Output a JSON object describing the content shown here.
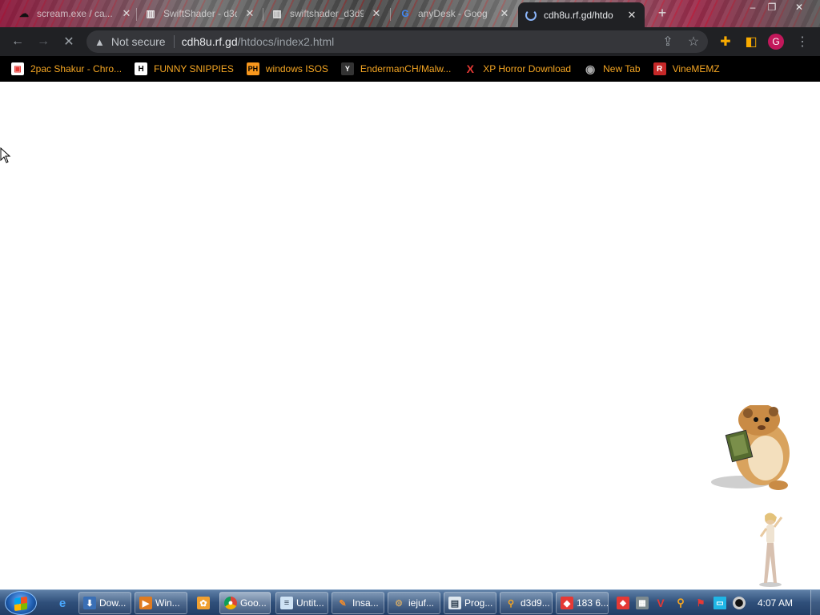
{
  "tabs": [
    {
      "title": "scream.exe / ca...",
      "icon": "cloud-favicon-icon"
    },
    {
      "title": "SwiftShader - d3d",
      "icon": "archive-favicon-icon"
    },
    {
      "title": "swiftshader_d3d9",
      "icon": "archive-favicon-icon"
    },
    {
      "title": "anyDesk - Goog",
      "icon": "google-favicon-icon"
    },
    {
      "title": "cdh8u.rf.gd/htdo",
      "icon": "loading-spinner-icon",
      "active": true
    }
  ],
  "new_tab_label": "+",
  "window_controls": {
    "minimize": "–",
    "maximize": "❐",
    "close": "✕"
  },
  "toolbar": {
    "security_text": "Not secure",
    "url_host": "cdh8u.rf.gd",
    "url_path": "/htdocs/index2.html",
    "profile_initial": "G"
  },
  "bookmarks": [
    {
      "label": "2pac Shakur - Chro...",
      "icon": "bag-icon",
      "color": "#e53935",
      "glyph": "▣"
    },
    {
      "label": "FUNNY SNIPPIES",
      "icon": "h-logo-icon",
      "color": "#ffffff",
      "glyph": "H"
    },
    {
      "label": "windows ISOS",
      "icon": "ph-logo-icon",
      "color": "#f7971d",
      "glyph": "PH"
    },
    {
      "label": "EndermanCH/Malw...",
      "icon": "yp-logo-icon",
      "color": "#333333",
      "glyph": "Y"
    },
    {
      "label": "XP Horror Download",
      "icon": "x-logo-icon",
      "color": "#e53935",
      "glyph": "X"
    },
    {
      "label": "New Tab",
      "icon": "globe-icon",
      "color": "#888888",
      "glyph": "◉"
    },
    {
      "label": "VineMEMZ",
      "icon": "r-logo-icon",
      "color": "#c62828",
      "glyph": "R"
    }
  ],
  "taskbar": {
    "tasks": [
      {
        "label": "",
        "icon": "ie-icon",
        "pinned": true
      },
      {
        "label": "Dow...",
        "icon": "download-icon"
      },
      {
        "label": "Win...",
        "icon": "media-player-icon"
      },
      {
        "label": "",
        "icon": "app-icon",
        "pinned": true
      },
      {
        "label": "Goo...",
        "icon": "chrome-icon",
        "active": true
      },
      {
        "label": "Untit...",
        "icon": "notepad-icon"
      },
      {
        "label": "Insa...",
        "icon": "paint-icon"
      },
      {
        "label": "iejuf...",
        "icon": "gear-app-icon"
      },
      {
        "label": "Prog...",
        "icon": "programs-icon"
      },
      {
        "label": "d3d9...",
        "icon": "search-app-icon"
      },
      {
        "label": "183 6...",
        "icon": "anydesk-icon"
      }
    ],
    "clock": "4:07 AM"
  }
}
